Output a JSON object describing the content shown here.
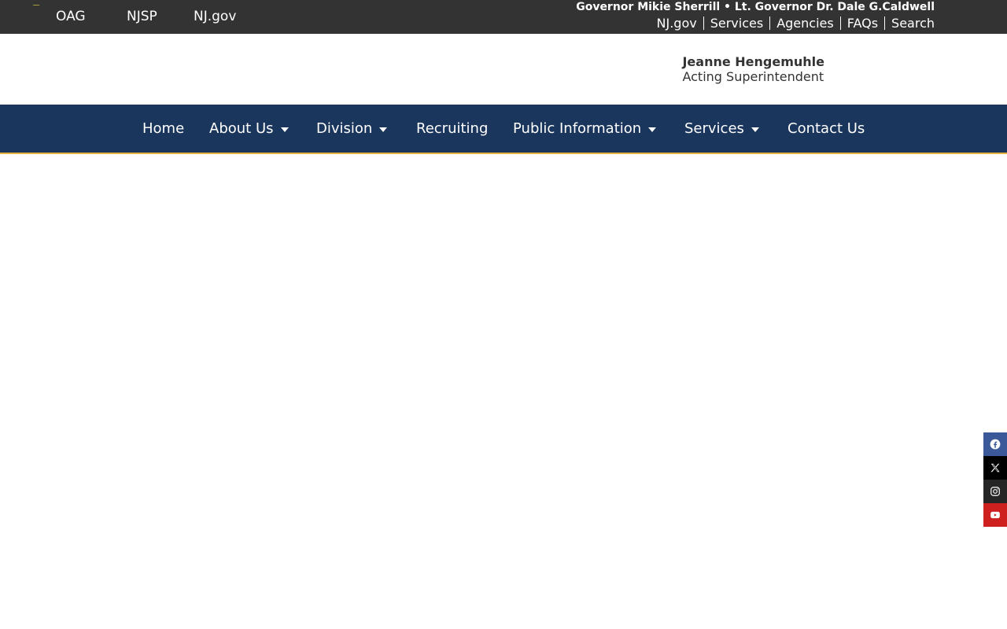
{
  "topbar": {
    "left_links": [
      "OAG",
      "NJSP",
      "NJ.gov"
    ],
    "governor_line": "Governor Mikie Sherrill • Lt. Governor Dr. Dale G.Caldwell",
    "right_links": [
      "NJ.gov",
      "Services",
      "Agencies",
      "FAQs",
      "Search"
    ]
  },
  "header": {
    "superintendent_name": "Jeanne Hengemuhle",
    "superintendent_title": "Acting Superintendent"
  },
  "nav": {
    "items": [
      {
        "label": "Home",
        "has_dropdown": false
      },
      {
        "label": "About Us",
        "has_dropdown": true
      },
      {
        "label": "Division",
        "has_dropdown": true
      },
      {
        "label": "Recruiting",
        "has_dropdown": false
      },
      {
        "label": "Public Information",
        "has_dropdown": true
      },
      {
        "label": "Services",
        "has_dropdown": true
      },
      {
        "label": "Contact Us",
        "has_dropdown": false
      }
    ]
  },
  "social": {
    "icons": [
      "facebook-icon",
      "x-icon",
      "instagram-icon",
      "youtube-icon"
    ]
  },
  "colors": {
    "topbar_bg": "#333333",
    "nav_bg": "#1b365d",
    "nav_accent": "#e8b33a",
    "facebook": "#3b5998",
    "x": "#000000",
    "instagram": "#262626",
    "youtube": "#cd201f"
  }
}
